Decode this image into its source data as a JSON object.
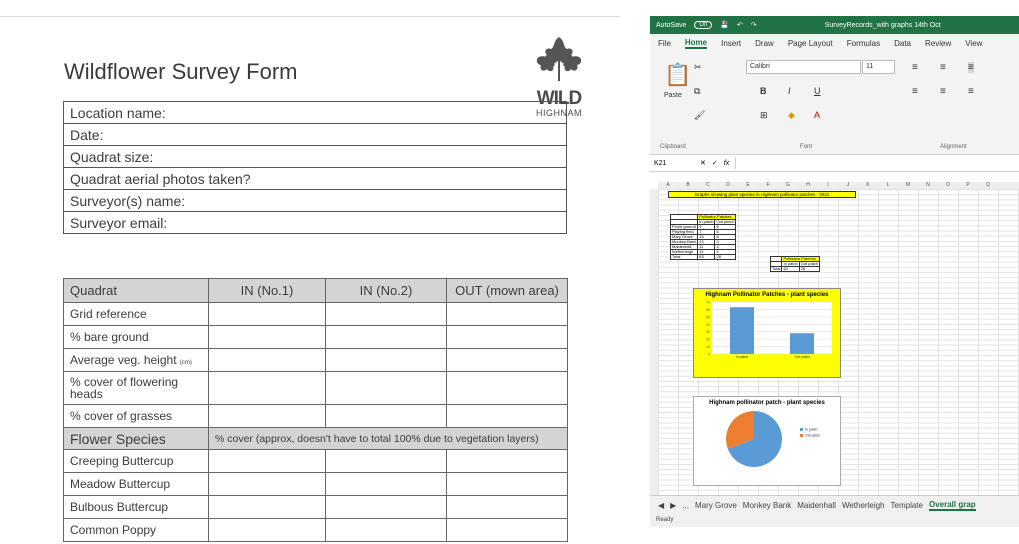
{
  "form": {
    "title": "Wildflower Survey Form",
    "logo_wild": "WILD",
    "logo_place": "HIGHNAM",
    "info_fields": [
      "Location name:",
      "Date:",
      "Quadrat size:",
      "Quadrat aerial photos taken?",
      "Surveyor(s) name:",
      "Surveyor email:"
    ],
    "quadrat_headers": [
      "Quadrat",
      "IN (No.1)",
      "IN (No.2)",
      "OUT (mown area)"
    ],
    "measure_rows": [
      "Grid reference",
      "% bare ground",
      "Average veg. height",
      "% cover of flowering heads",
      "% cover of grasses"
    ],
    "veg_height_unit": "(cm)",
    "species_header": "Flower Species",
    "species_note": "% cover (approx, doesn't have to total 100% due to vegetation layers)",
    "species": [
      "Creeping Buttercup",
      "Meadow Buttercup",
      "Bulbous Buttercup",
      "Common Poppy"
    ]
  },
  "excel": {
    "autosave": "AutoSave",
    "autosave_state": "Off",
    "file_name": "SurveyRecords_with graphs 14th Oct",
    "menu": [
      "File",
      "Home",
      "Insert",
      "Draw",
      "Page Layout",
      "Formulas",
      "Data",
      "Review",
      "View"
    ],
    "font_name": "Calibri",
    "font_size": "11",
    "paste_label": "Paste",
    "groups": [
      "Clipboard",
      "Font",
      "Alignment"
    ],
    "cell_ref": "K21",
    "fx": "fx",
    "banner": "Graphs showing plant species in Highnam pollinator patches - 2021",
    "table1": {
      "title": "Pollinator Patches",
      "cols": [
        "",
        "In patch",
        "Out patch"
      ],
      "rows": [
        [
          "Poole ground",
          "9",
          "6"
        ],
        [
          "Playing field",
          "7",
          "6"
        ],
        [
          "Mary Grove",
          "15",
          "8"
        ],
        [
          "Monkey Bank",
          "10",
          "0"
        ],
        [
          "Maidenhall",
          "11",
          "4"
        ],
        [
          "Wetherleigh",
          "11",
          "4"
        ],
        [
          "Total",
          "63",
          "28"
        ]
      ]
    },
    "table2": {
      "title": "Pollinator Patches",
      "cols": [
        "",
        "In patch",
        "Out patch"
      ],
      "rows": [
        [
          "Total",
          "63",
          "28"
        ]
      ]
    },
    "sheet_tabs": [
      "Mary Grove",
      "Monkey Bank",
      "Maidenhall",
      "Wetherleigh",
      "Template",
      "Overall grap"
    ],
    "status": "Ready"
  },
  "chart_data": [
    {
      "type": "bar",
      "title": "Highnam Pollinator Patches - plant species",
      "categories": [
        "In patch",
        "Out patch"
      ],
      "values": [
        63,
        28
      ],
      "ylim": [
        0,
        70
      ],
      "yticks": [
        0,
        10,
        20,
        30,
        40,
        50,
        60,
        70
      ],
      "grid": true,
      "colors": [
        "#5b9bd5"
      ]
    },
    {
      "type": "pie",
      "title": "Highnam pollinator patch - plant species",
      "labels": [
        "In patch",
        "Out patch"
      ],
      "values": [
        63,
        28
      ],
      "colors": [
        "#5b9bd5",
        "#ed7d31"
      ],
      "legend": "right"
    }
  ]
}
